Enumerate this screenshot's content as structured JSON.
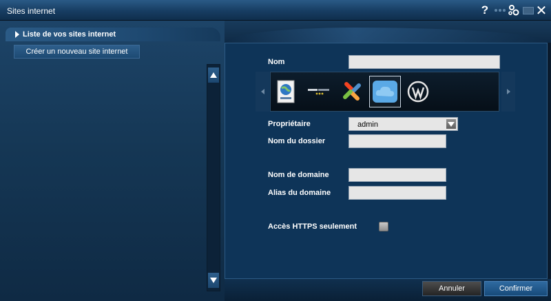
{
  "window": {
    "title": "Sites internet"
  },
  "titlebar": {
    "icons": [
      "help-icon",
      "dots-icon",
      "gears-icon",
      "minimize-icon",
      "close-icon"
    ],
    "help_glyph": "?",
    "close_glyph": "✕"
  },
  "sidebar": {
    "list_title": "Liste de vos sites internet",
    "create_button": "Créer un nouveau site internet"
  },
  "form": {
    "name_label": "Nom",
    "name_value": "",
    "owner_label": "Propriétaire",
    "owner_value": "admin",
    "folder_label": "Nom du dossier",
    "folder_value": "",
    "domain_label": "Nom de domaine",
    "domain_value": "",
    "alias_label": "Alias du domaine",
    "alias_value": "",
    "https_label": "Accès HTTPS seulement",
    "https_checked": false
  },
  "carousel": {
    "items": [
      {
        "icon": "www-globe-icon",
        "selected": false
      },
      {
        "icon": "dotclear-logo-icon",
        "selected": false
      },
      {
        "icon": "joomla-logo-icon",
        "selected": false
      },
      {
        "icon": "cloud-icon",
        "selected": true
      },
      {
        "icon": "wordpress-logo-icon",
        "selected": false
      }
    ]
  },
  "buttons": {
    "cancel": "Annuler",
    "confirm": "Confirmer"
  },
  "colors": {
    "panel": "#0e3458",
    "confirm": "#2f6aa0",
    "cancel": "#3a3a3a"
  }
}
